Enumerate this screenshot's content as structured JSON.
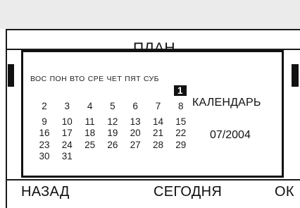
{
  "header": {
    "title": "ПЛАН"
  },
  "calendar": {
    "weekdays": [
      "ВОС",
      "ПОН",
      "ВТО",
      "СРЕ",
      "ЧЕТ",
      "ПЯТ",
      "СУБ"
    ],
    "rows": [
      [
        "",
        "",
        "",
        "",
        "",
        "",
        "1"
      ],
      [
        "2",
        "3",
        "4",
        "5",
        "6",
        "7",
        "8"
      ],
      [
        "9",
        "10",
        "11",
        "12",
        "13",
        "14",
        "15"
      ],
      [
        "16",
        "17",
        "18",
        "19",
        "20",
        "21",
        "22"
      ],
      [
        "23",
        "24",
        "25",
        "26",
        "27",
        "28",
        "29"
      ],
      [
        "30",
        "31",
        "",
        "",
        "",
        "",
        ""
      ]
    ],
    "selected_day": "1",
    "side_label": "КАЛЕНДАРЬ",
    "month_year": "07/2004"
  },
  "softkeys": {
    "left": "НАЗАД",
    "middle": "СЕГОДНЯ",
    "right": "ОК"
  }
}
